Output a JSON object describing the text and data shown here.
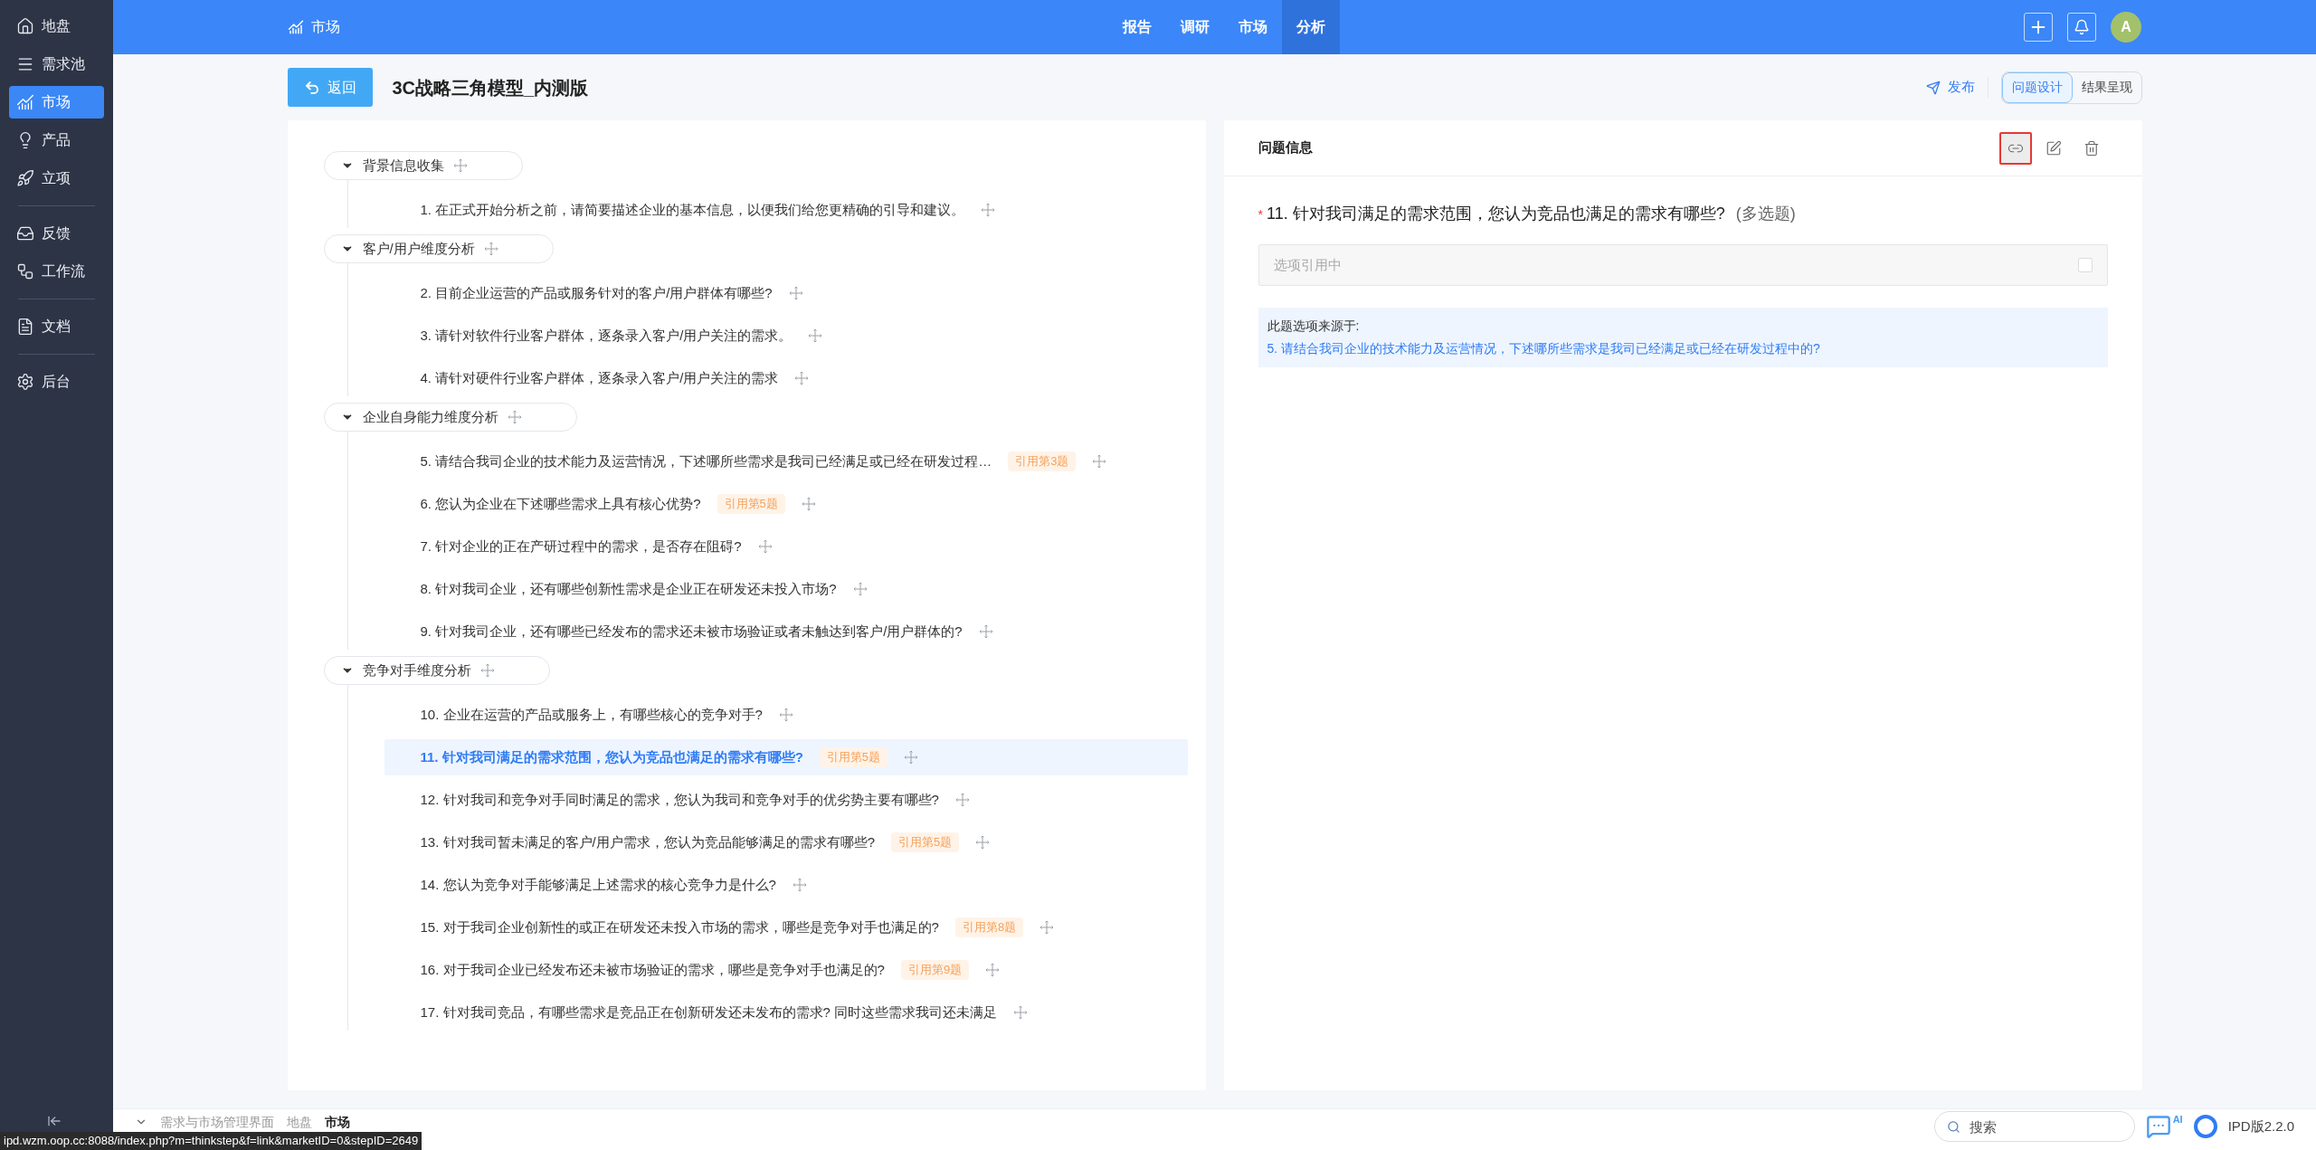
{
  "sidebar": {
    "groups": [
      [
        {
          "label": "地盘",
          "selected": false
        },
        {
          "label": "需求池",
          "selected": false
        },
        {
          "label": "市场",
          "selected": true
        },
        {
          "label": "产品",
          "selected": false
        },
        {
          "label": "立项",
          "selected": false
        }
      ],
      [
        {
          "label": "反馈",
          "selected": false
        },
        {
          "label": "工作流",
          "selected": false
        }
      ],
      [
        {
          "label": "文档",
          "selected": false
        }
      ],
      [
        {
          "label": "后台",
          "selected": false
        }
      ]
    ]
  },
  "topbar": {
    "module": "市场",
    "nav": [
      {
        "label": "报告",
        "selected": false
      },
      {
        "label": "调研",
        "selected": false
      },
      {
        "label": "市场",
        "selected": false
      },
      {
        "label": "分析",
        "selected": true
      }
    ],
    "avatar": "A"
  },
  "header": {
    "back_button": "返回",
    "title": "3C战略三角模型_内测版",
    "publish": "发布",
    "view_tabs": [
      {
        "label": "问题设计",
        "selected": true
      },
      {
        "label": "结果呈现",
        "selected": false
      }
    ]
  },
  "outline": {
    "sections": [
      {
        "title": "背景信息收集",
        "expanded": true,
        "children": [
          {
            "text": "1. 在正式开始分析之前，请简要描述企业的基本信息，以便我们给您更精确的引导和建议。",
            "selected": false
          }
        ]
      },
      {
        "title": "客户/用户维度分析",
        "expanded": true,
        "children": [
          {
            "text": "2. 目前企业运营的产品或服务针对的客户/用户群体有哪些?",
            "selected": false
          },
          {
            "text": "3. 请针对软件行业客户群体，逐条录入客户/用户关注的需求。",
            "selected": false
          },
          {
            "text": "4. 请针对硬件行业客户群体，逐条录入客户/用户关注的需求",
            "selected": false
          }
        ]
      },
      {
        "title": "企业自身能力维度分析",
        "expanded": true,
        "children": [
          {
            "text": "5. 请结合我司企业的技术能力及运营情况，下述哪所些需求是我司已经满足或已经在研发过程…",
            "selected": false,
            "reference": "引用第3题"
          },
          {
            "text": "6. 您认为企业在下述哪些需求上具有核心优势?",
            "selected": false,
            "reference": "引用第5题"
          },
          {
            "text": "7. 针对企业的正在产研过程中的需求，是否存在阻碍?",
            "selected": false
          },
          {
            "text": "8. 针对我司企业，还有哪些创新性需求是企业正在研发还未投入市场?",
            "selected": false
          },
          {
            "text": "9. 针对我司企业，还有哪些已经发布的需求还未被市场验证或者未触达到客户/用户群体的?",
            "selected": false
          }
        ]
      },
      {
        "title": "竞争对手维度分析",
        "expanded": true,
        "children": [
          {
            "text": "10. 企业在运营的产品或服务上，有哪些核心的竞争对手?",
            "selected": false
          },
          {
            "text": "11. 针对我司满足的需求范围，您认为竞品也满足的需求有哪些?",
            "selected": true,
            "reference": "引用第5题"
          },
          {
            "text": "12. 针对我司和竞争对手同时满足的需求，您认为我司和竞争对手的优劣势主要有哪些?",
            "selected": false
          },
          {
            "text": "13. 针对我司暂未满足的客户/用户需求，您认为竞品能够满足的需求有哪些?",
            "selected": false,
            "reference": "引用第5题"
          },
          {
            "text": "14. 您认为竞争对手能够满足上述需求的核心竞争力是什么?",
            "selected": false
          },
          {
            "text": "15. 对于我司企业创新性的或正在研发还未投入市场的需求，哪些是竞争对手也满足的?",
            "selected": false,
            "reference": "引用第8题"
          },
          {
            "text": "16. 对于我司企业已经发布还未被市场验证的需求，哪些是竞争对手也满足的?",
            "selected": false,
            "reference": "引用第9题"
          },
          {
            "text": "17. 针对我司竞品，有哪些需求是竞品正在创新研发还未发布的需求? 同时这些需求我司还未满足",
            "selected": false
          }
        ]
      }
    ]
  },
  "detail": {
    "title": "问题信息",
    "tools": [
      {
        "kind": "link",
        "selected": true
      },
      {
        "kind": "edit",
        "selected": false
      },
      {
        "kind": "delete",
        "selected": false
      }
    ],
    "question": {
      "required": true,
      "required_mark": "*",
      "text": "11. 针对我司满足的需求范围，您认为竞品也满足的需求有哪些?",
      "type": "(多选题)"
    },
    "option": {
      "placeholder": "选项引用中",
      "checked": false
    },
    "source": {
      "label": "此题选项来源于:",
      "link": "5. 请结合我司企业的技术能力及运营情况，下述哪所些需求是我司已经满足或已经在研发过程中的?"
    }
  },
  "bottom_bar": {
    "breadcrumb": [
      "需求与市场管理界面",
      "地盘",
      "市场"
    ],
    "search": {
      "placeholder": "搜索"
    },
    "ai_badge": "AI",
    "version": "IPD版2.2.0",
    "status_url": "ipd.wzm.oop.cc:8088/index.php?m=thinkstep&f=link&marketID=0&stepID=2649"
  }
}
